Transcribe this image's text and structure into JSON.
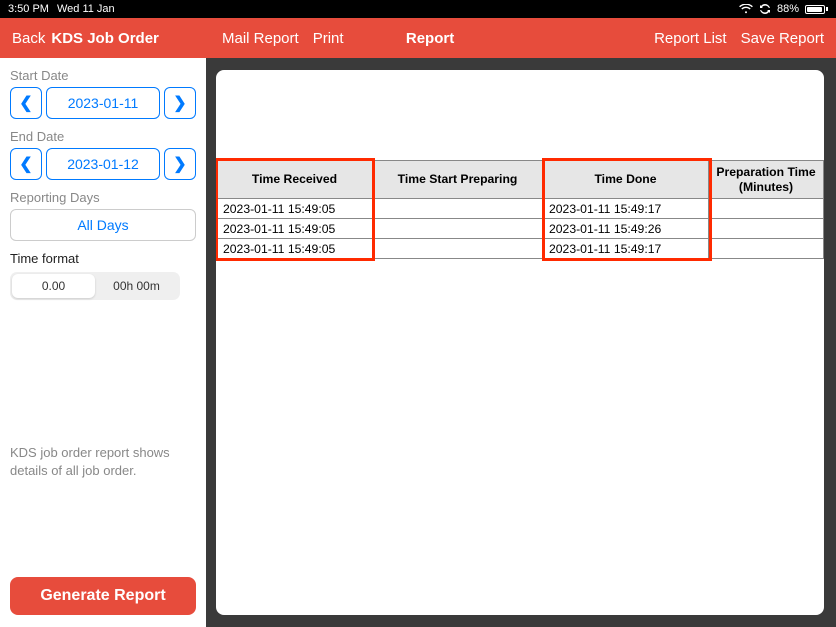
{
  "statusbar": {
    "time": "3:50 PM",
    "date": "Wed 11 Jan",
    "battery_pct": "88%"
  },
  "toolbar": {
    "back": "Back",
    "title": "KDS Job Order",
    "mail_report": "Mail Report",
    "print": "Print",
    "center_title": "Report",
    "report_list": "Report List",
    "save_report": "Save Report"
  },
  "sidebar": {
    "start_date_label": "Start Date",
    "start_date": "2023-01-11",
    "end_date_label": "End Date",
    "end_date": "2023-01-12",
    "reporting_days_label": "Reporting Days",
    "all_days": "All Days",
    "time_format_label": "Time format",
    "time_format_options": {
      "decimal": "0.00",
      "hm": "00h 00m"
    },
    "description": "KDS job order report shows details of all job order.",
    "generate": "Generate Report"
  },
  "table": {
    "headers": {
      "received": "Time Received",
      "start": "Time Start Preparing",
      "done": "Time Done",
      "prep": "Preparation Time (Minutes)"
    },
    "rows": [
      {
        "received": "2023-01-11 15:49:05",
        "start": "",
        "done": "2023-01-11 15:49:17",
        "prep": ""
      },
      {
        "received": "2023-01-11 15:49:05",
        "start": "",
        "done": "2023-01-11 15:49:26",
        "prep": ""
      },
      {
        "received": "2023-01-11 15:49:05",
        "start": "",
        "done": "2023-01-11 15:49:17",
        "prep": ""
      }
    ]
  }
}
